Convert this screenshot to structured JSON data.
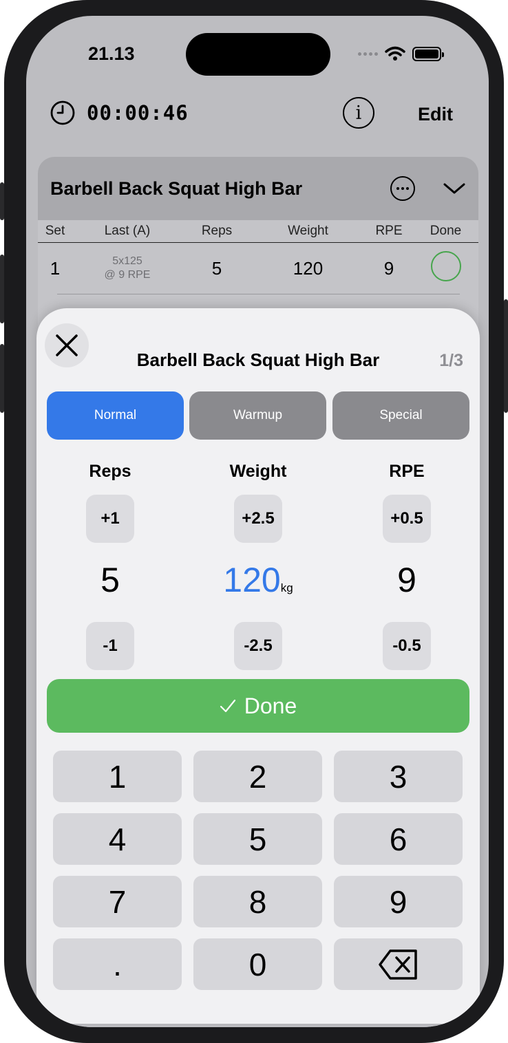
{
  "status_bar": {
    "time": "21.13"
  },
  "top_bar": {
    "timer": "00:00:46",
    "edit_label": "Edit"
  },
  "exercise_card": {
    "title": "Barbell Back Squat High Bar",
    "columns": [
      "Set",
      "Last (A)",
      "Reps",
      "Weight",
      "RPE",
      "Done"
    ],
    "rows": [
      {
        "set": "1",
        "last_line1": "5x125",
        "last_line2": "@ 9 RPE",
        "reps": "5",
        "weight": "120",
        "rpe": "9"
      }
    ]
  },
  "sheet": {
    "title": "Barbell Back Squat High Bar",
    "counter": "1/3",
    "set_types": [
      {
        "label": "Normal",
        "active": true
      },
      {
        "label": "Warmup",
        "active": false
      },
      {
        "label": "Special",
        "active": false
      }
    ],
    "fields": {
      "reps": {
        "label": "Reps",
        "plus": "+1",
        "value": "5",
        "minus": "-1"
      },
      "weight": {
        "label": "Weight",
        "plus": "+2.5",
        "value": "120",
        "unit": "kg",
        "minus": "-2.5"
      },
      "rpe": {
        "label": "RPE",
        "plus": "+0.5",
        "value": "9",
        "minus": "-0.5"
      }
    },
    "done_label": "Done",
    "keypad": [
      "1",
      "2",
      "3",
      "4",
      "5",
      "6",
      "7",
      "8",
      "9",
      ".",
      "0"
    ]
  },
  "colors": {
    "accent": "#3479e8",
    "done_green": "#5cba5f",
    "inactive_segment": "#8a8a8e"
  },
  "icons": [
    "clock-icon",
    "info-icon",
    "more-icon",
    "chevron-down-icon",
    "close-icon",
    "checkmark-icon",
    "backspace-icon",
    "wifi-icon",
    "battery-icon"
  ]
}
